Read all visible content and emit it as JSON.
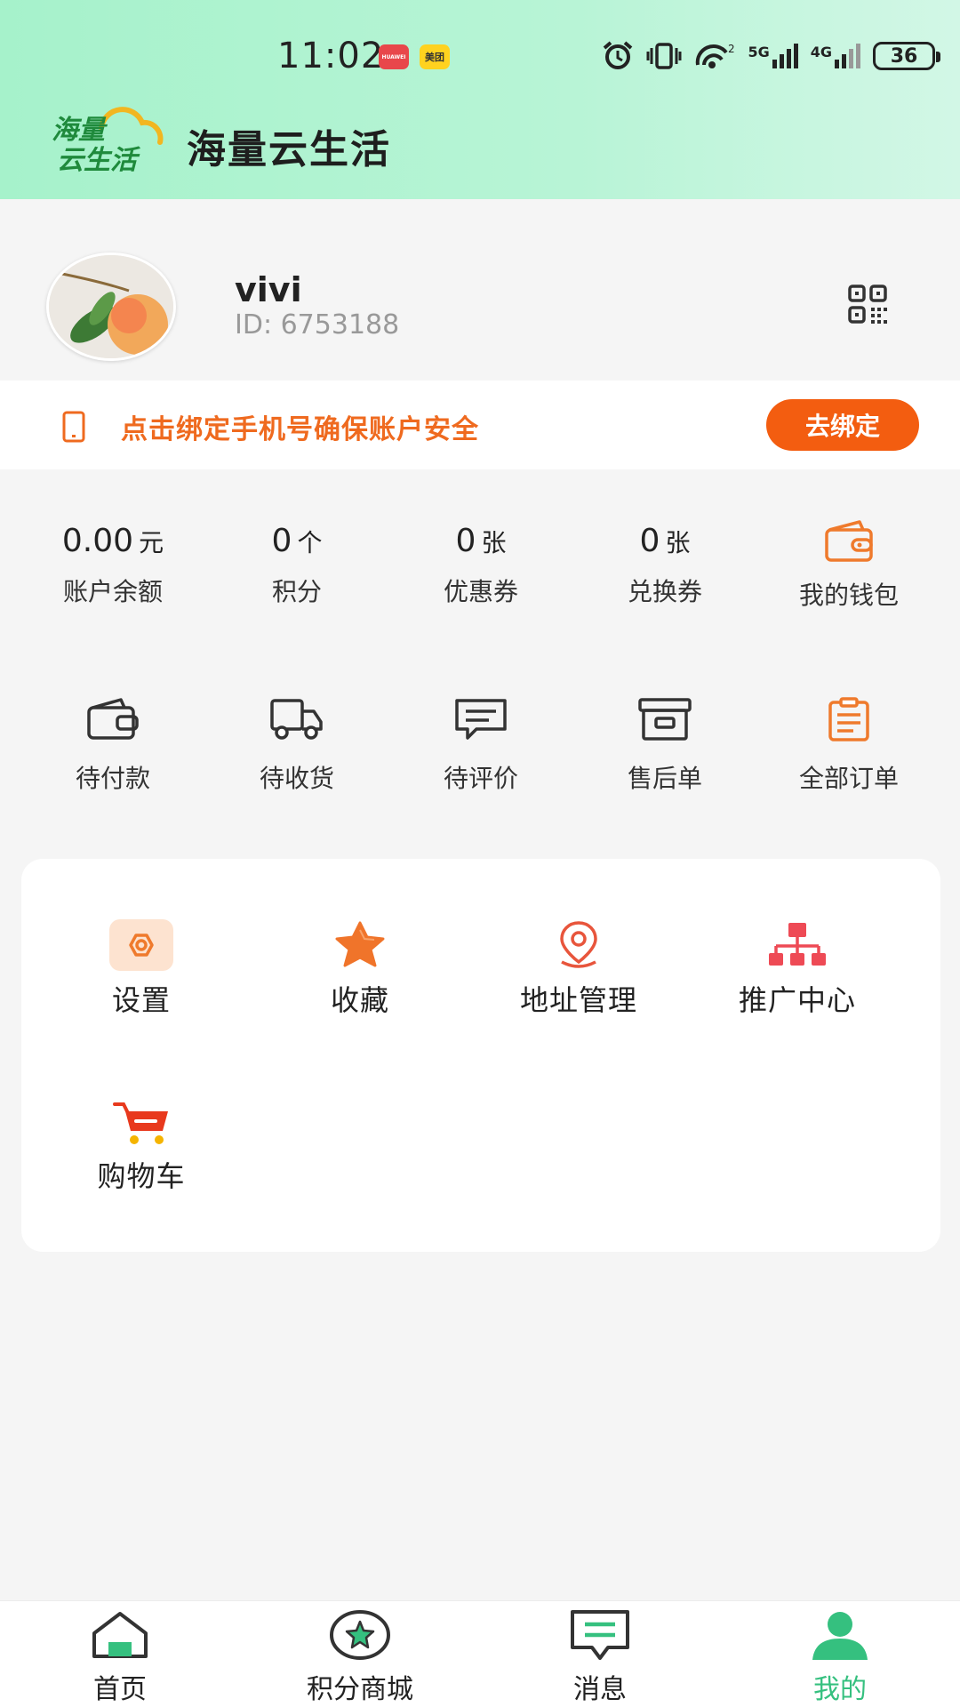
{
  "status_bar": {
    "time": "11:02",
    "app_badges": [
      "HUAWEI",
      "美团"
    ],
    "network_labels": [
      "5G",
      "4G"
    ],
    "battery": "36"
  },
  "brand": {
    "logo_text": "海量云生活",
    "name": "海量云生活"
  },
  "profile": {
    "username": "vivi",
    "user_id": "ID: 6753188"
  },
  "bind_phone": {
    "message": "点击绑定手机号确保账户安全",
    "button": "去绑定"
  },
  "stats": [
    {
      "value": "0.00",
      "unit": "元",
      "label": "账户余额"
    },
    {
      "value": "0",
      "unit": "个",
      "label": "积分"
    },
    {
      "value": "0",
      "unit": "张",
      "label": "优惠券"
    },
    {
      "value": "0",
      "unit": "张",
      "label": "兑换券"
    }
  ],
  "wallet": {
    "label": "我的钱包",
    "icon": "wallet-icon"
  },
  "orders": [
    {
      "label": "待付款",
      "icon": "wallet-outline-icon"
    },
    {
      "label": "待收货",
      "icon": "truck-icon"
    },
    {
      "label": "待评价",
      "icon": "comment-icon"
    },
    {
      "label": "售后单",
      "icon": "archive-box-icon"
    },
    {
      "label": "全部订单",
      "icon": "clipboard-icon"
    }
  ],
  "tools": [
    {
      "label": "设置",
      "icon": "settings-icon"
    },
    {
      "label": "收藏",
      "icon": "star-icon"
    },
    {
      "label": "地址管理",
      "icon": "location-pin-icon"
    },
    {
      "label": "推广中心",
      "icon": "org-chart-icon"
    },
    {
      "label": "购物车",
      "icon": "shopping-cart-icon"
    }
  ],
  "tabbar": [
    {
      "label": "首页",
      "icon": "home-icon"
    },
    {
      "label": "积分商城",
      "icon": "points-star-icon"
    },
    {
      "label": "消息",
      "icon": "message-icon"
    },
    {
      "label": "我的",
      "icon": "user-icon",
      "active": true
    }
  ],
  "colors": {
    "accent_orange": "#f35d10",
    "icon_orange": "#ef7a2c",
    "active_green": "#35c07f",
    "header_green": "#a6f2cb"
  }
}
